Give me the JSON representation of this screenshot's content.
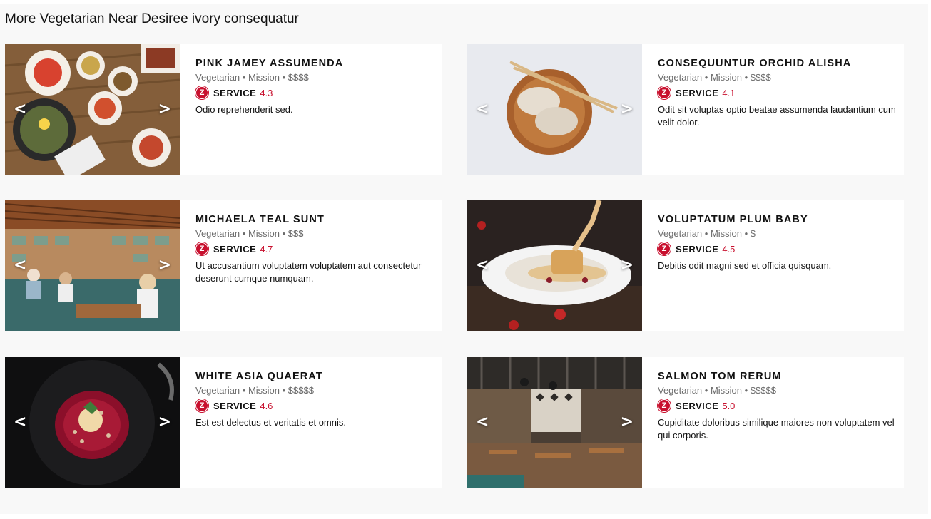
{
  "section": {
    "title": "More Vegetarian Near Desiree ivory consequatur"
  },
  "carousel": {
    "prev": "<",
    "next": ">"
  },
  "brand": {
    "accent": "#c8102e",
    "badge_letter": "Z"
  },
  "cards": [
    {
      "name": "PINK JAMEY ASSUMENDA",
      "meta": "Vegetarian • Mission • $$$$",
      "service_label": "SERVICE",
      "score": "4.3",
      "desc": "Odio reprehenderit sed.",
      "image": "korean-table-dishes"
    },
    {
      "name": "CONSEQUUNTUR ORCHID ALISHA",
      "meta": "Vegetarian • Mission • $$$$",
      "service_label": "SERVICE",
      "score": "4.1",
      "desc": "Odit sit voluptas optio beatae assumenda laudantium cum velit dolor.",
      "image": "dumplings-wooden-bowl"
    },
    {
      "name": "MICHAELA TEAL SUNT",
      "meta": "Vegetarian • Mission • $$$",
      "service_label": "SERVICE",
      "score": "4.7",
      "desc": "Ut accusantium voluptatem voluptatem aut consectetur deserunt cumque numquam.",
      "image": "restaurant-interior-diners"
    },
    {
      "name": "VOLUPTATUM PLUM BABY",
      "meta": "Vegetarian • Mission • $",
      "service_label": "SERVICE",
      "score": "4.5",
      "desc": "Debitis odit magni sed et officia quisquam.",
      "image": "dessert-sauce-pour"
    },
    {
      "name": "WHITE ASIA QUAERAT",
      "meta": "Vegetarian • Mission • $$$$$",
      "service_label": "SERVICE",
      "score": "4.6",
      "desc": "Est est delectus et veritatis et omnis.",
      "image": "dessert-berry-plate"
    },
    {
      "name": "SALMON TOM RERUM",
      "meta": "Vegetarian • Mission • $$$$$",
      "service_label": "SERVICE",
      "score": "5.0",
      "desc": "Cupiditate doloribus similique maiores non voluptatem vel qui corporis.",
      "image": "industrial-restaurant-interior"
    }
  ]
}
